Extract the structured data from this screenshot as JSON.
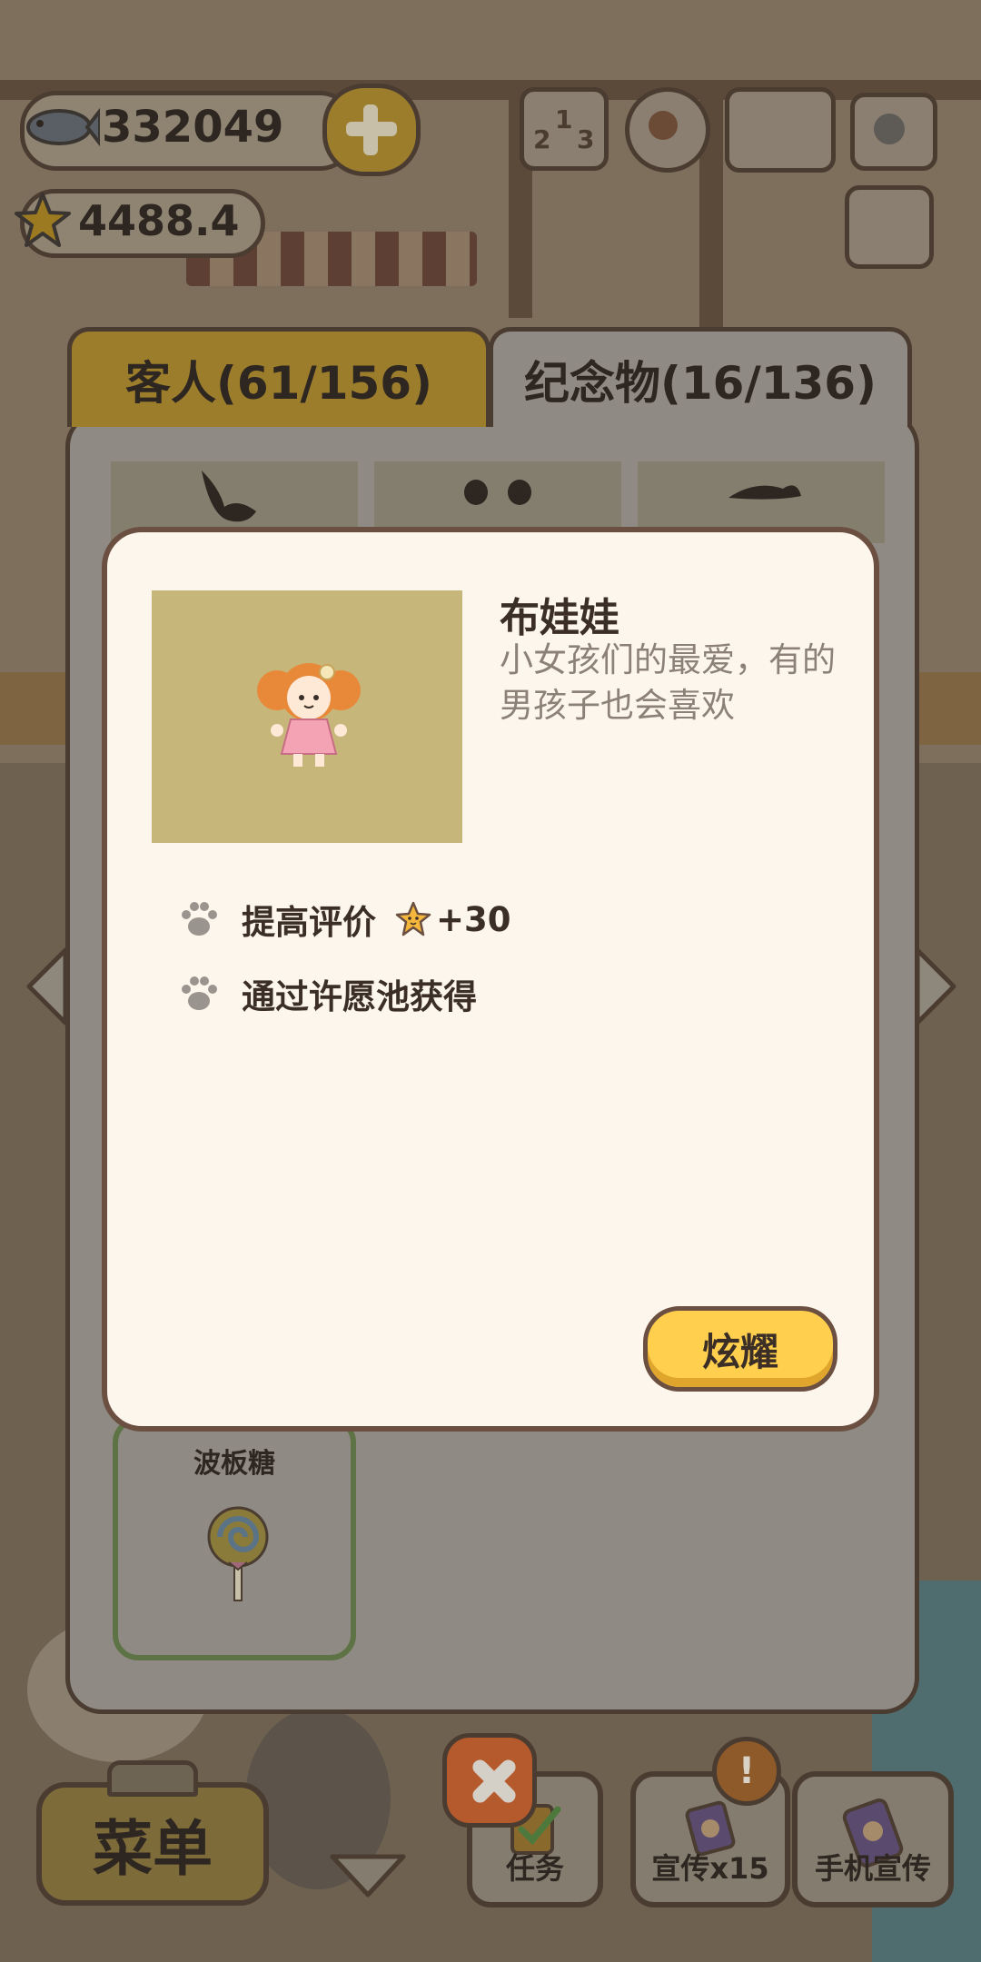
{
  "hud": {
    "fish_count": "332049",
    "star_rating": "4488.4"
  },
  "tabs": [
    {
      "label": "客人(61/156)",
      "active": false
    },
    {
      "label": "纪念物(16/136)",
      "active": true
    }
  ],
  "collection": {
    "visible_item_label": "波板糖"
  },
  "detail": {
    "name": "布娃娃",
    "description": "小女孩们的最爱，有的男孩子也会喜欢",
    "attributes": [
      {
        "label": "提高评价",
        "bonus": "+30",
        "icon": "paw-icon"
      },
      {
        "label": "通过许愿池获得",
        "icon": "paw-icon"
      }
    ],
    "show_button": "炫耀"
  },
  "bottom_bar": {
    "menu_label": "菜单",
    "task_label": "任务",
    "promo_label": "宣传x15",
    "phone_promo_label": "手机宣传",
    "alert_badge": "!"
  },
  "colors": {
    "dialog_bg": "#fdf6ec",
    "dialog_border": "#6b4f40",
    "button_yellow": "#ffcf4d",
    "thumb_bg": "#c7b679",
    "tab_active": "#9b7d2c"
  }
}
